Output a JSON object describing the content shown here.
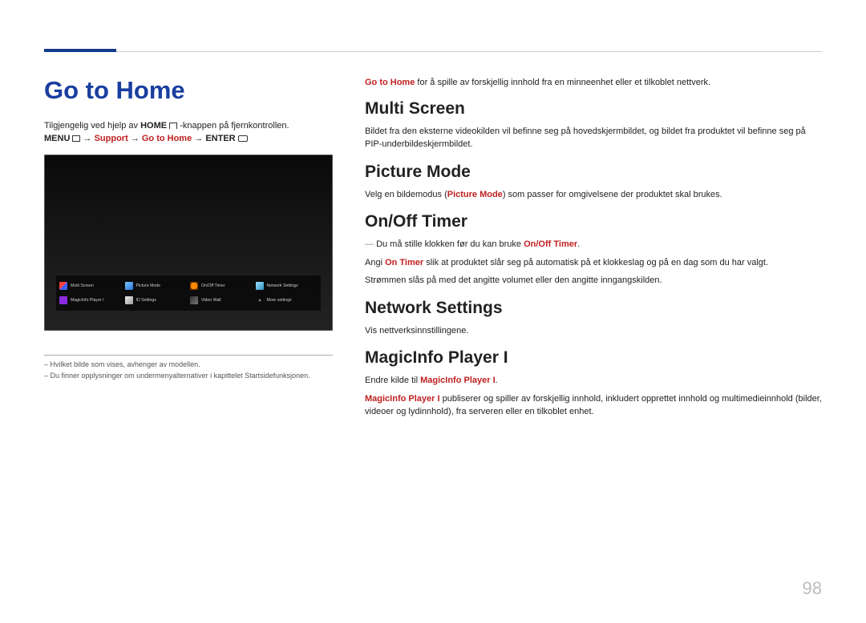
{
  "page_title": "Go to Home",
  "intro_prefix": "Tilgjengelig ved hjelp av ",
  "intro_home": "HOME",
  "intro_suffix": "-knappen på fjernkontrollen.",
  "breadcrumb": {
    "menu": "MENU",
    "arrow": " → ",
    "support": "Support",
    "gotohome": "Go to Home",
    "enter": "ENTER"
  },
  "toolbar_items_row1": [
    "Multi Screen",
    "Picture Mode",
    "On/Off Timer",
    "Network Settings"
  ],
  "toolbar_items_row2": [
    "MagicInfo Player I",
    "ID Settings",
    "Video Wall",
    "More settings"
  ],
  "left_footnote1": "Hvilket bilde som vises, avhenger av modellen.",
  "left_footnote2": "Du finner opplysninger om undermenyalternativer i kapittelet Startsidefunksjonen.",
  "right": {
    "intro_prefix": "Go to Home",
    "intro_body": " for å spille av forskjellig innhold fra en minneenhet eller et tilkoblet nettverk.",
    "multi_title": "Multi Screen",
    "multi_body": "Bildet fra den eksterne videokilden vil befinne seg på hovedskjermbildet, og bildet fra produktet vil befinne seg på PIP-underbildeskjermbildet.",
    "picture_title": "Picture Mode",
    "picture_pre": "Velg en bildemodus (",
    "picture_red": "Picture Mode",
    "picture_post": ") som passer for omgivelsene der produktet skal brukes.",
    "onoff_title": "On/Off Timer",
    "onoff_note_pre": "Du må stille klokken før du kan bruke ",
    "onoff_note_red": "On/Off Timer",
    "onoff_note_post": ".",
    "onoff_angi_pre": "Angi ",
    "onoff_angi_red": "On Timer",
    "onoff_angi_post": " slik at produktet slår seg på automatisk på et klokkeslag og på en dag som du har valgt.",
    "onoff_line3": "Strømmen slås på med det angitte volumet eller den angitte inngangskilden.",
    "net_title": "Network Settings",
    "net_body": "Vis nettverksinnstillingene.",
    "magic_title": "MagicInfo Player I",
    "magic_line1_pre": "Endre kilde til ",
    "magic_line1_red": "MagicInfo Player I",
    "magic_line1_post": ".",
    "magic_line2_red": "MagicInfo Player I",
    "magic_line2_post": " publiserer og spiller av forskjellig innhold, inkludert opprettet innhold og multimedieinnhold (bilder, videoer og lydinnhold), fra serveren eller en tilkoblet enhet."
  },
  "page_number": "98"
}
